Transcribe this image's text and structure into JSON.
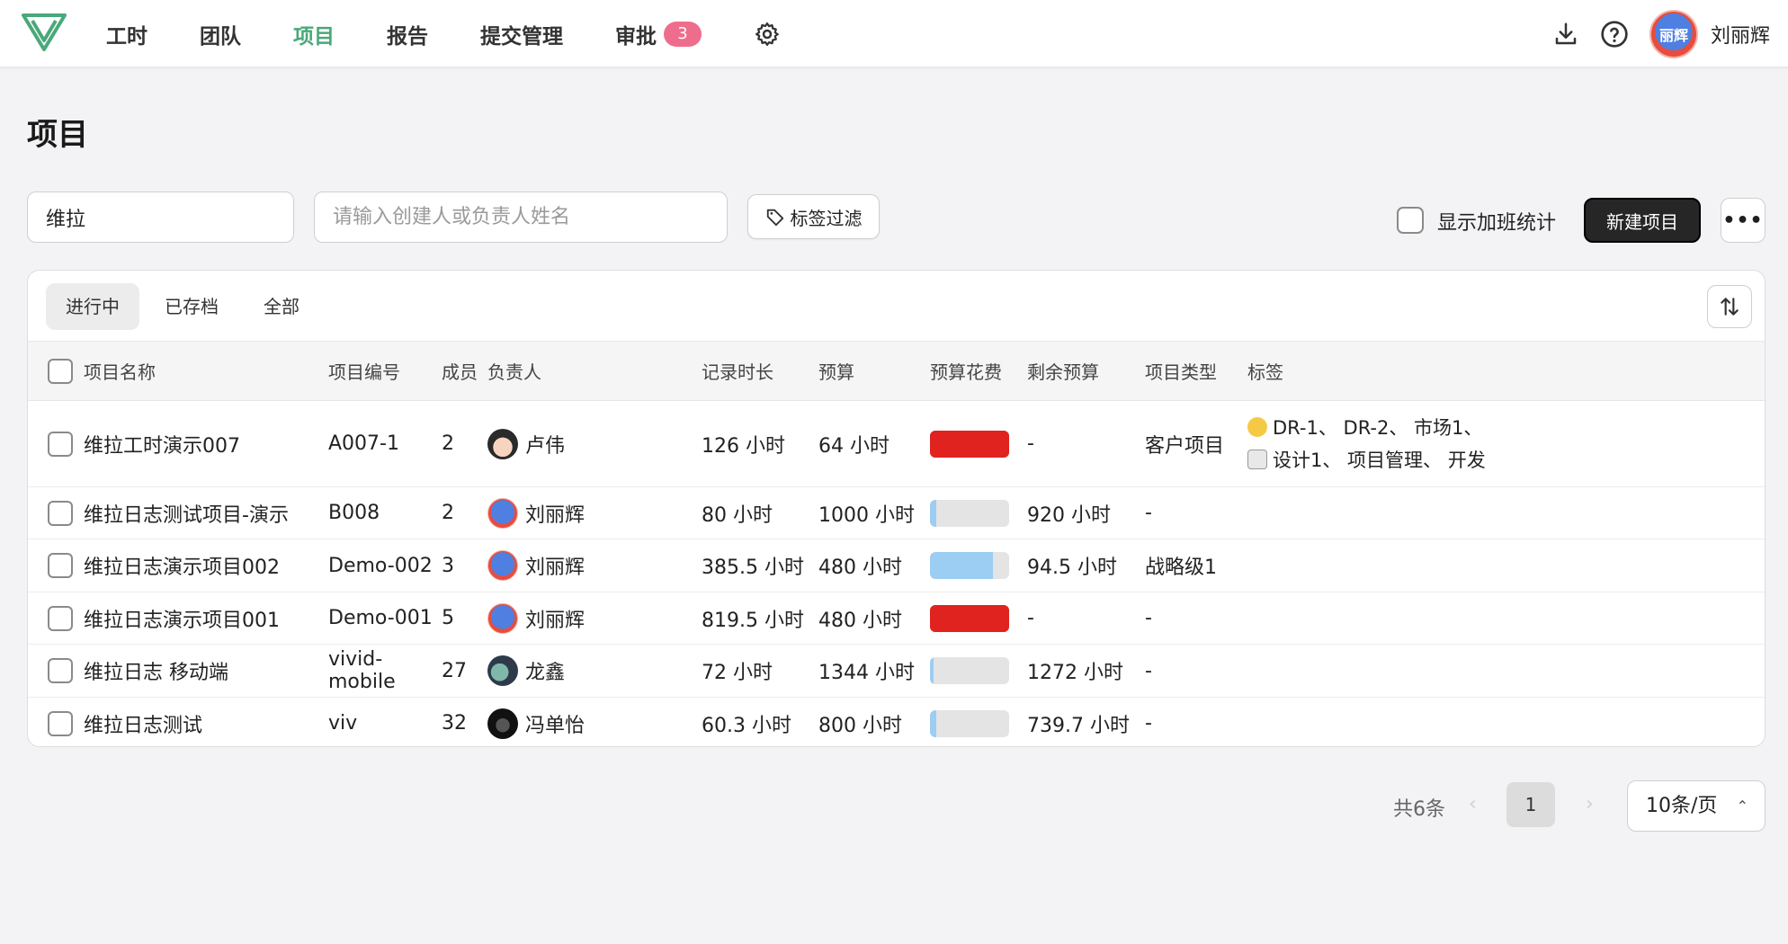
{
  "nav": {
    "items": [
      {
        "label": "工时",
        "active": false
      },
      {
        "label": "团队",
        "active": false
      },
      {
        "label": "项目",
        "active": true
      },
      {
        "label": "报告",
        "active": false
      },
      {
        "label": "提交管理",
        "active": false
      },
      {
        "label": "审批",
        "active": false
      }
    ],
    "approval_badge": "3",
    "accent_color": "#4aa87a",
    "badge_color": "#ef6d8c"
  },
  "user": {
    "avatar_text": "丽辉",
    "name": "刘丽辉"
  },
  "page": {
    "title": "项目"
  },
  "filters": {
    "keyword_value": "维拉",
    "person_placeholder": "请输入创建人或负责人姓名",
    "tag_filter_label": "标签过滤",
    "overtime_label": "显示加班统计",
    "new_project_label": "新建项目",
    "more_label": "•••"
  },
  "tabs": [
    {
      "label": "进行中",
      "active": true
    },
    {
      "label": "已存档",
      "active": false
    },
    {
      "label": "全部",
      "active": false
    }
  ],
  "table": {
    "columns": [
      "项目名称",
      "项目编号",
      "成员",
      "负责人",
      "记录时长",
      "预算",
      "预算花费",
      "剩余预算",
      "项目类型",
      "标签"
    ],
    "rows": [
      {
        "name": "维拉工时演示007",
        "code": "A007-1",
        "members": "2",
        "owner": "卢伟",
        "owner_avatar": "av-lu",
        "logged": "126 小时",
        "budget": "64 小时",
        "spent_fraction": 1.97,
        "remaining": "-",
        "type": "客户项目",
        "tags_line1": "DR-1、 DR-2、 市场1、",
        "tags_line2": "设计1、 项目管理、 开发"
      },
      {
        "name": "维拉日志测试项目-演示",
        "code": "B008",
        "members": "2",
        "owner": "刘丽辉",
        "owner_avatar": "av-li",
        "logged": "80 小时",
        "budget": "1000 小时",
        "spent_fraction": 0.08,
        "remaining": "920 小时",
        "type": "-",
        "tags_line1": "",
        "tags_line2": ""
      },
      {
        "name": "维拉日志演示项目002",
        "code": "Demo-002",
        "members": "3",
        "owner": "刘丽辉",
        "owner_avatar": "av-li",
        "logged": "385.5 小时",
        "budget": "480 小时",
        "spent_fraction": 0.8,
        "remaining": "94.5 小时",
        "type": "战略级1",
        "tags_line1": "",
        "tags_line2": ""
      },
      {
        "name": "维拉日志演示项目001",
        "code": "Demo-001",
        "members": "5",
        "owner": "刘丽辉",
        "owner_avatar": "av-li",
        "logged": "819.5 小时",
        "budget": "480 小时",
        "spent_fraction": 1.71,
        "remaining": "-",
        "type": "-",
        "tags_line1": "",
        "tags_line2": ""
      },
      {
        "name": "维拉日志 移动端",
        "code": "vivid-mobile",
        "members": "27",
        "owner": "龙鑫",
        "owner_avatar": "av-long",
        "logged": "72 小时",
        "budget": "1344 小时",
        "spent_fraction": 0.05,
        "remaining": "1272 小时",
        "type": "-",
        "tags_line1": "",
        "tags_line2": ""
      },
      {
        "name": "维拉日志测试",
        "code": "viv",
        "members": "32",
        "owner": "冯单怡",
        "owner_avatar": "av-feng",
        "logged": "60.3 小时",
        "budget": "800 小时",
        "spent_fraction": 0.08,
        "remaining": "739.7 小时",
        "type": "-",
        "tags_line1": "",
        "tags_line2": ""
      }
    ]
  },
  "pagination": {
    "total": "共6条",
    "current_page": "1",
    "page_size": "10条/页"
  }
}
